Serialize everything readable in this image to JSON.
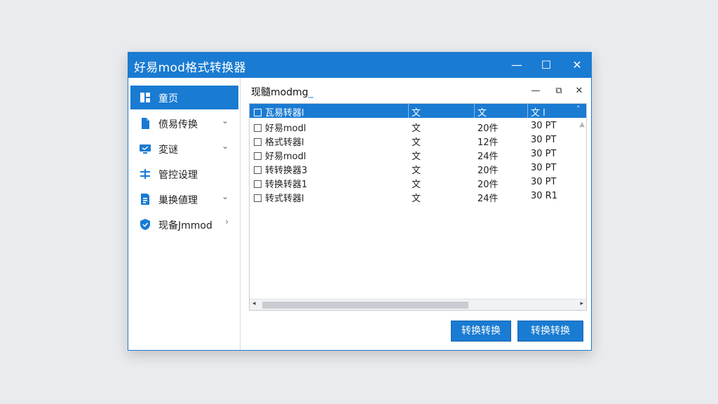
{
  "window": {
    "title": "好易mod格式转换器",
    "controls": {
      "minimize": "—",
      "maximize": "☐",
      "close": "✕"
    }
  },
  "sidebar": {
    "items": [
      {
        "label": "童页",
        "icon": "document-split-icon",
        "active": true,
        "chevron": ""
      },
      {
        "label": "偾易传换",
        "icon": "file-icon",
        "active": false,
        "chevron": "⌄"
      },
      {
        "label": "変谜",
        "icon": "monitor-icon",
        "active": false,
        "chevron": "⌄"
      },
      {
        "label": "管控设理",
        "icon": "equalizer-icon",
        "active": false,
        "chevron": ""
      },
      {
        "label": "巢换値理",
        "icon": "document-list-icon",
        "active": false,
        "chevron": "⌄"
      },
      {
        "label": "现备Jmmod",
        "icon": "shield-icon",
        "active": false,
        "chevron": "›"
      }
    ]
  },
  "panel": {
    "title": "现髓modmg",
    "caret": "_",
    "controls": {
      "minimize": "—",
      "restore": "⧉",
      "close": "✕"
    }
  },
  "table": {
    "columns": [
      "瓦易转器l",
      "文",
      "文",
      "文 l"
    ],
    "sort_indicator": "˄",
    "rows": [
      [
        "好易modl",
        "文",
        "20件",
        "30 PT"
      ],
      [
        "格式转器l",
        "文",
        "12件",
        "30 PT"
      ],
      [
        "好易modl",
        "文",
        "24件",
        "30 PT"
      ],
      [
        "转转换器3",
        "文",
        "20件",
        "30 PT"
      ],
      [
        "转换转器1",
        "文",
        "20件",
        "30 PT"
      ],
      [
        "转式转器l",
        "文",
        "24件",
        "30 R1"
      ]
    ],
    "scroll": {
      "left": "◂",
      "right": "▸",
      "up": "▲"
    }
  },
  "buttons": {
    "convert_primary": "转换转换",
    "convert_secondary": "转换转换"
  },
  "colors": {
    "accent": "#1a7bd2",
    "background": "#e9ebee"
  }
}
